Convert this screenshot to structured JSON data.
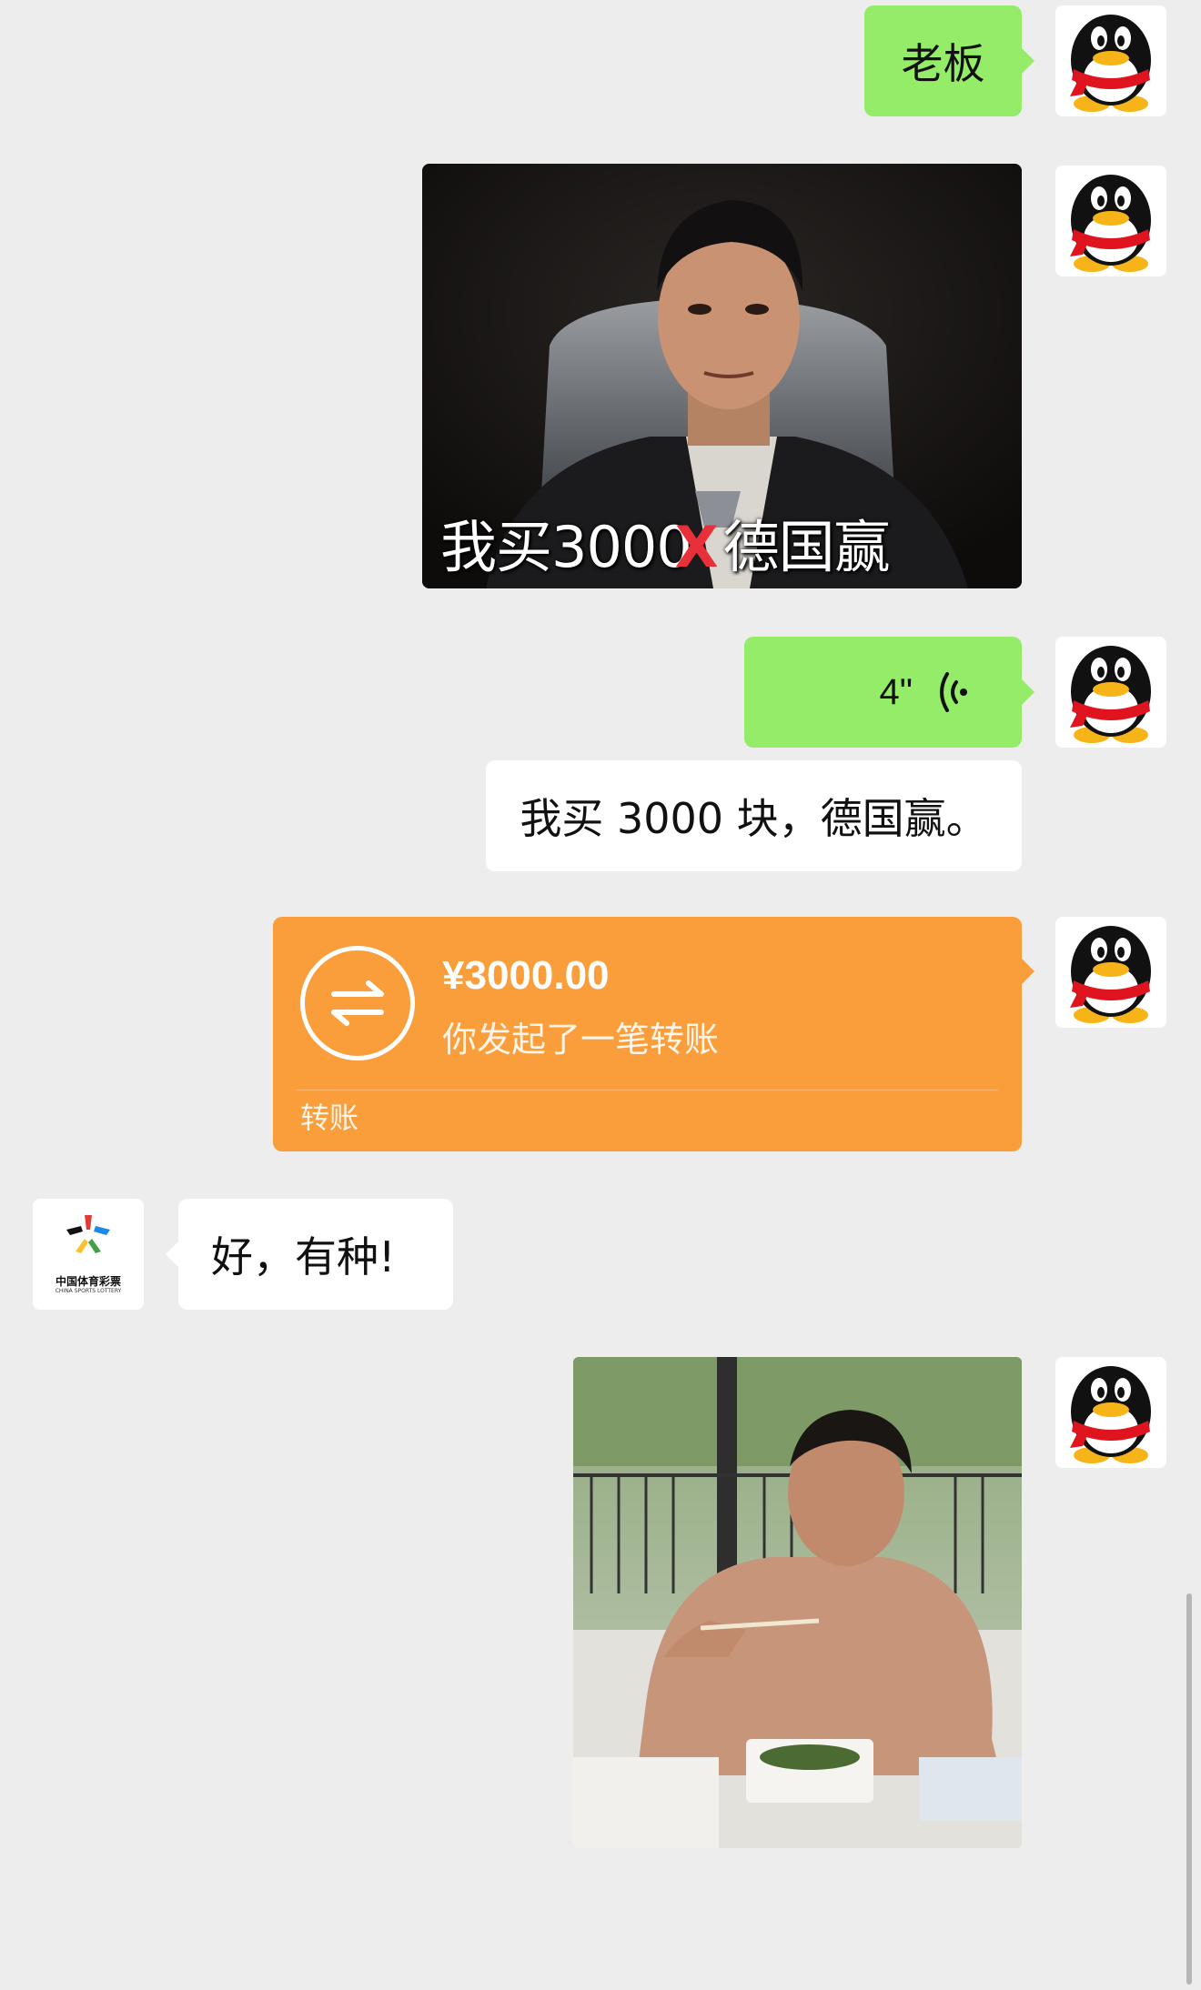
{
  "messages": {
    "m1_text": "老板",
    "m2_meme_caption_a": "我买3000",
    "m2_meme_caption_mark": "X",
    "m2_meme_caption_b": "德国赢",
    "m3_voice_duration": "4\"",
    "m4_transcript": "我买 3000 块，德国赢。",
    "m5_transfer": {
      "amount": "¥3000.00",
      "description": "你发起了一笔转账",
      "label": "转账"
    },
    "m6_reply": "好，有种!"
  },
  "contact": {
    "logo_text_cn": "中国体育彩票",
    "logo_text_en": "CHINA SPORTS LOTTERY"
  },
  "colors": {
    "background": "#ededed",
    "bubble_green": "#95ec69",
    "bubble_white": "#ffffff",
    "transfer_orange": "#fa9d3b"
  },
  "icons": {
    "user_avatar": "qq-penguin-icon",
    "voice": "voice-wave-icon",
    "transfer": "transfer-arrows-icon"
  }
}
